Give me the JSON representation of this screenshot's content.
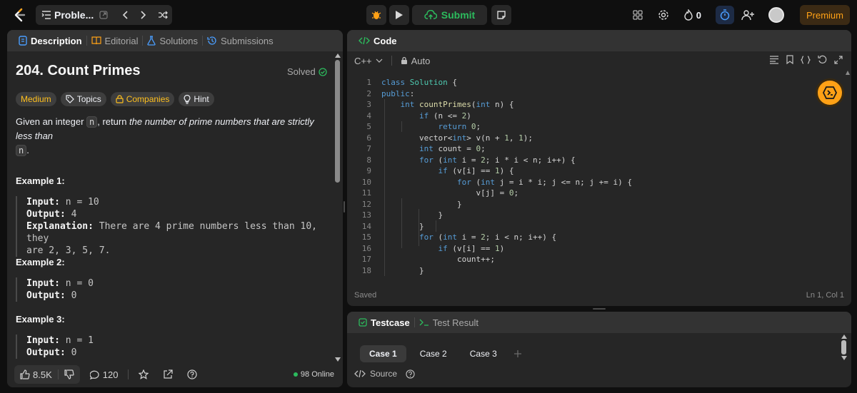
{
  "topbar": {
    "problem_list_label": "Proble...",
    "submit_label": "Submit",
    "streak_count": "0",
    "premium_label": "Premium"
  },
  "description_panel": {
    "tabs": [
      {
        "label": "Description",
        "icon": "doc-icon",
        "active": true
      },
      {
        "label": "Editorial",
        "icon": "book-icon",
        "active": false
      },
      {
        "label": "Solutions",
        "icon": "flask-icon",
        "active": false
      },
      {
        "label": "Submissions",
        "icon": "history-icon",
        "active": false
      }
    ],
    "title": "204. Count Primes",
    "solved_label": "Solved",
    "chips": {
      "difficulty": "Medium",
      "topics": "Topics",
      "companies": "Companies",
      "hint": "Hint"
    },
    "statement": {
      "prefix": "Given an integer ",
      "var1": "n",
      "middle": ", return ",
      "emphasis": "the number of prime numbers that are strictly less than",
      "var2": "n",
      "suffix": "."
    },
    "examples": [
      {
        "heading": "Example 1:",
        "input_label": "Input:",
        "input": " n = 10",
        "output_label": "Output:",
        "output": " 4",
        "explanation_label": "Explanation:",
        "explanation_line1": " There are 4 prime numbers less than 10, they",
        "explanation_line2": "are 2, 3, 5, 7."
      },
      {
        "heading": "Example 2:",
        "input_label": "Input:",
        "input": " n = 0",
        "output_label": "Output:",
        "output": " 0"
      },
      {
        "heading": "Example 3:",
        "input_label": "Input:",
        "input": " n = 1",
        "output_label": "Output:",
        "output": " 0"
      }
    ],
    "footer": {
      "likes": "8.5K",
      "comments": "120",
      "online": "98 Online"
    }
  },
  "code_panel": {
    "title": "Code",
    "language": "C++",
    "mode": "Auto",
    "line_numbers": [
      "1",
      "2",
      "3",
      "4",
      "5",
      "6",
      "7",
      "8",
      "9",
      "10",
      "11",
      "12",
      "13",
      "14",
      "15",
      "16",
      "17",
      "18"
    ],
    "status_left": "Saved",
    "status_right": "Ln 1, Col 1"
  },
  "test_panel": {
    "tabs": [
      {
        "label": "Testcase",
        "active": true
      },
      {
        "label": "Test Result",
        "active": false
      }
    ],
    "cases": [
      "Case 1",
      "Case 2",
      "Case 3"
    ],
    "source_label": "Source"
  },
  "colors": {
    "accent_green": "#2cbb5d",
    "medium_yellow": "#ffc01e",
    "premium_orange": "#ffa116",
    "keyword_blue": "#569cd6"
  }
}
